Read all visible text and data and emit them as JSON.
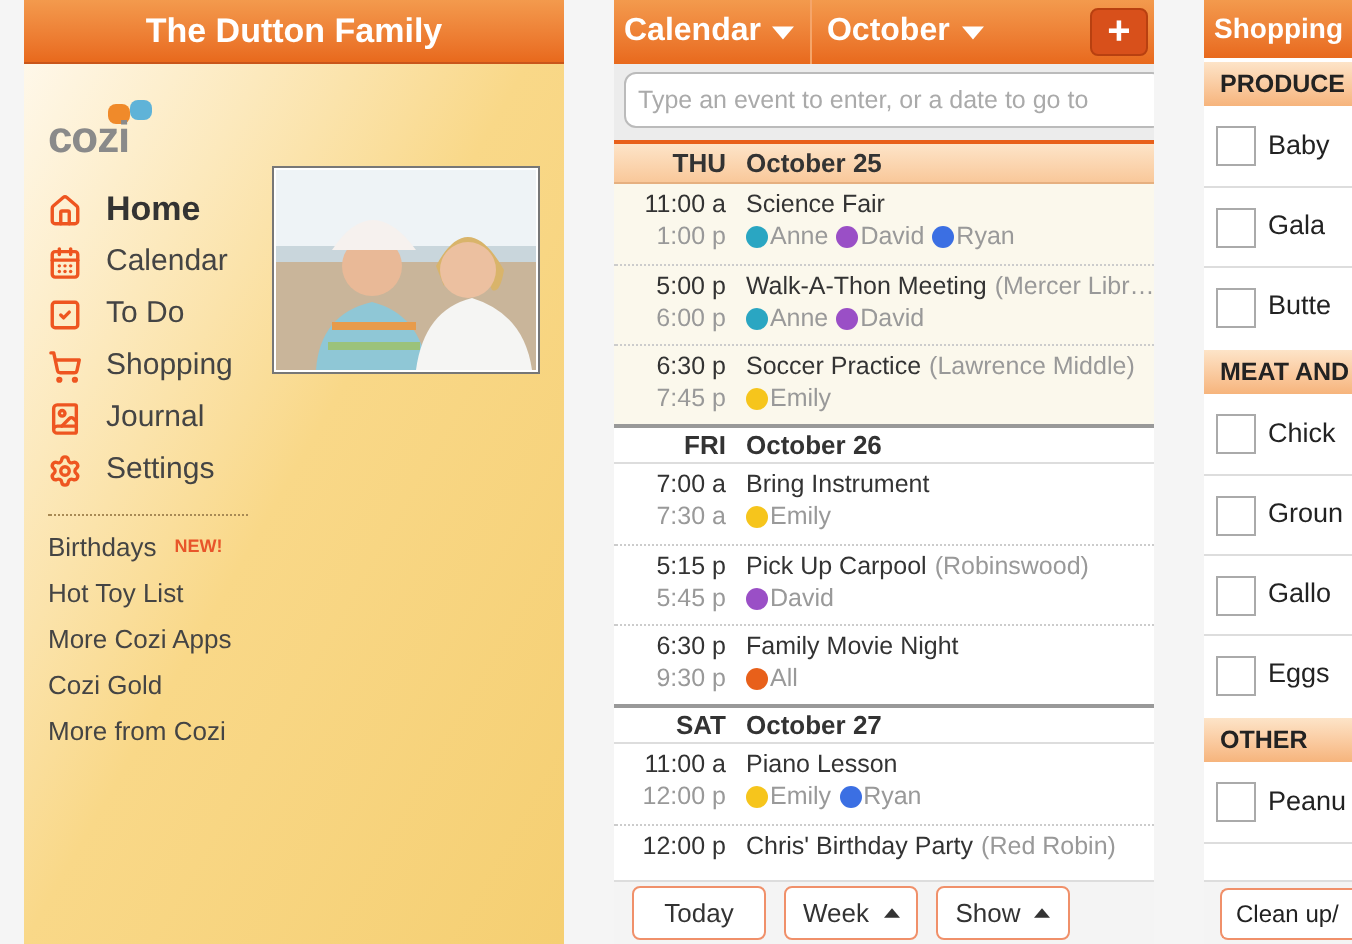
{
  "home": {
    "title": "The Dutton Family",
    "logo": "cozi",
    "menu": [
      {
        "label": "Home",
        "selected": true
      },
      {
        "label": "Calendar",
        "selected": false
      },
      {
        "label": "To Do",
        "selected": false
      },
      {
        "label": "Shopping",
        "selected": false
      },
      {
        "label": "Journal",
        "selected": false
      },
      {
        "label": "Settings",
        "selected": false
      }
    ],
    "links": [
      {
        "label": "Birthdays",
        "badge": "NEW!"
      },
      {
        "label": "Hot Toy List"
      },
      {
        "label": "More Cozi Apps"
      },
      {
        "label": "Cozi Gold"
      },
      {
        "label": "More from Cozi"
      }
    ]
  },
  "calendar": {
    "menus": [
      "Calendar",
      "October"
    ],
    "add_button": "+",
    "search": {
      "placeholder": "Type an event to enter, or a date to go to"
    },
    "days": [
      {
        "weekday": "THU",
        "date": "October 25",
        "highlighted": true,
        "events": [
          {
            "start": "11:00 a",
            "end": "1:00 p",
            "title": "Science Fair",
            "people": [
              {
                "name": "Anne",
                "color": "#2aa6c2"
              },
              {
                "name": "David",
                "color": "#9a4fc6"
              },
              {
                "name": "Ryan",
                "color": "#3b6fe3"
              }
            ]
          },
          {
            "start": "5:00 p",
            "end": "6:00 p",
            "title": "Walk-A-Thon Meeting",
            "place": "(Mercer Libr…",
            "people": [
              {
                "name": "Anne",
                "color": "#2aa6c2"
              },
              {
                "name": "David",
                "color": "#9a4fc6"
              }
            ]
          },
          {
            "start": "6:30 p",
            "end": "7:45 p",
            "title": "Soccer Practice",
            "place": "(Lawrence Middle)",
            "people": [
              {
                "name": "Emily",
                "color": "#f6c51c"
              }
            ]
          }
        ]
      },
      {
        "weekday": "FRI",
        "date": "October 26",
        "highlighted": false,
        "events": [
          {
            "start": "7:00 a",
            "end": "7:30 a",
            "title": "Bring Instrument",
            "people": [
              {
                "name": "Emily",
                "color": "#f6c51c"
              }
            ]
          },
          {
            "start": "5:15 p",
            "end": "5:45 p",
            "title": "Pick Up Carpool",
            "place": "(Robinswood)",
            "people": [
              {
                "name": "David",
                "color": "#9a4fc6"
              }
            ]
          },
          {
            "start": "6:30 p",
            "end": "9:30 p",
            "title": "Family Movie Night",
            "people": [
              {
                "name": "All",
                "color": "#e8601a"
              }
            ]
          }
        ]
      },
      {
        "weekday": "SAT",
        "date": "October 27",
        "highlighted": false,
        "events": [
          {
            "start": "11:00 a",
            "end": "12:00 p",
            "title": "Piano Lesson",
            "people": [
              {
                "name": "Emily",
                "color": "#f6c51c"
              },
              {
                "name": "Ryan",
                "color": "#3b6fe3"
              }
            ]
          },
          {
            "start": "12:00 p",
            "title": "Chris' Birthday Party",
            "place": "(Red Robin)"
          }
        ]
      }
    ],
    "buttons": [
      {
        "label": "Today",
        "menu": false
      },
      {
        "label": "Week",
        "menu": true
      },
      {
        "label": "Show",
        "menu": true
      }
    ]
  },
  "shopping": {
    "title": "Shopping",
    "sections": [
      {
        "name": "PRODUCE",
        "items": [
          {
            "label": "Baby",
            "checked": false
          },
          {
            "label": "Gala",
            "checked": false
          },
          {
            "label": "Butte",
            "checked": false
          }
        ]
      },
      {
        "name": "MEAT AND",
        "items": [
          {
            "label": "Chick",
            "checked": false
          },
          {
            "label": "Groun",
            "checked": false
          },
          {
            "label": "Gallo",
            "checked": false
          },
          {
            "label": "Eggs",
            "checked": false
          }
        ]
      },
      {
        "name": "OTHER",
        "items": [
          {
            "label": "Peanu",
            "checked": false
          }
        ]
      }
    ],
    "button": "Clean up/"
  }
}
